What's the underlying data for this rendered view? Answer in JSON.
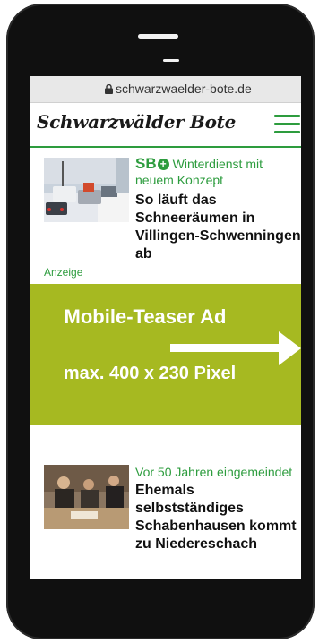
{
  "browser": {
    "url": "schwarzwaelder-bote.de"
  },
  "site": {
    "logo": "Schwarzwälder Bote"
  },
  "articles": [
    {
      "badge": "SB",
      "kicker": "Winterdienst mit neuem Konzept",
      "headline_lines": [
        "So läuft das",
        "Schneeräumen in",
        "Villingen-Schwenningen",
        "ab"
      ]
    },
    {
      "kicker": "Vor 50 Jahren eingemeindet",
      "headline_lines": [
        "Ehemals selbstständiges",
        "Schabenhausen kommt",
        "zu Niedereschach"
      ]
    }
  ],
  "ad": {
    "label": "Anzeige",
    "line1": "Mobile-Teaser Ad",
    "line2": "max. 400 x 230 Pixel"
  },
  "colors": {
    "brand_green": "#2d9c3e",
    "ad_background": "#a6b921",
    "phone_frame": "#101010"
  }
}
